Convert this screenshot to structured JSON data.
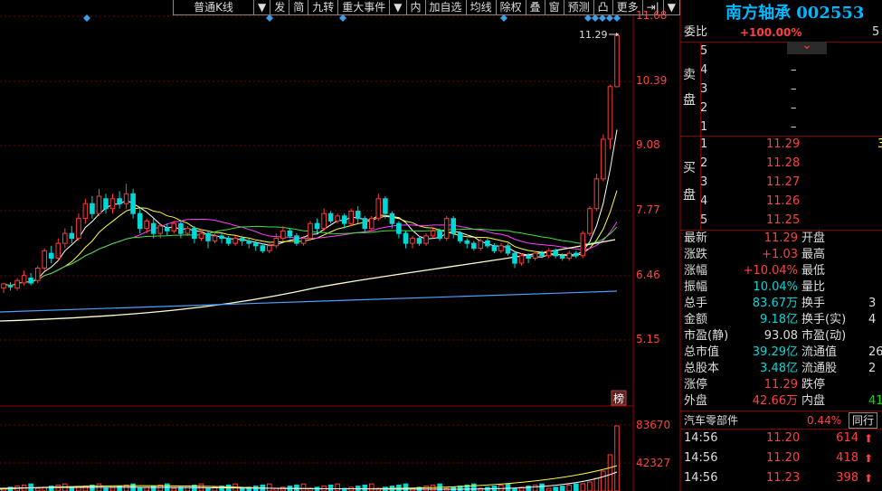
{
  "toolbar": {
    "buttons": [
      "普通K线",
      "▼",
      "发",
      "简",
      "九转",
      "重大事件",
      "▼",
      "内",
      "加自选",
      "均线",
      "除权",
      "叠",
      "窗",
      "预测",
      "凸",
      "更多",
      "⇥|",
      "▼"
    ]
  },
  "price_axis": [
    "11.68",
    "10.39",
    "9.08",
    "7.77",
    "6.46",
    "5.15"
  ],
  "volume_axis": [
    "83670",
    "42327"
  ],
  "chart_marker": "11.29",
  "bang_label": "榜",
  "stock": {
    "name": "南方轴承",
    "code": "002553"
  },
  "weibi": {
    "label": "委比",
    "value": "+100.00%",
    "extra": "5"
  },
  "sell_label": [
    "卖",
    "盘"
  ],
  "buy_label": [
    "买",
    "盘"
  ],
  "sell_rows": [
    {
      "level": "5",
      "price": "–"
    },
    {
      "level": "4",
      "price": "–"
    },
    {
      "level": "3",
      "price": "–"
    },
    {
      "level": "2",
      "price": "–"
    },
    {
      "level": "1",
      "price": "–"
    }
  ],
  "buy_rows": [
    {
      "level": "1",
      "price": "11.29",
      "vol": "3"
    },
    {
      "level": "2",
      "price": "11.28",
      "vol": ""
    },
    {
      "level": "3",
      "price": "11.27",
      "vol": ""
    },
    {
      "level": "4",
      "price": "11.26",
      "vol": ""
    },
    {
      "level": "5",
      "price": "11.25",
      "vol": ""
    }
  ],
  "quote": [
    {
      "l1": "最新",
      "v1": "11.29",
      "l2": "开盘",
      "v2": ""
    },
    {
      "l1": "涨跌",
      "v1": "+1.03",
      "l2": "最高",
      "v2": ""
    },
    {
      "l1": "涨幅",
      "v1": "+10.04%",
      "l2": "最低",
      "v2": ""
    },
    {
      "l1": "振幅",
      "v1": "10.04%",
      "l2": "量比",
      "v2": ""
    },
    {
      "l1": "总手",
      "v1": "83.67万",
      "l2": "换手",
      "v2": "3"
    },
    {
      "l1": "金额",
      "v1": "9.18亿",
      "l2": "换手(实)",
      "v2": "4"
    },
    {
      "l1": "市盈(静)",
      "v1": "93.08",
      "l2": "市盈(动)",
      "v2": ""
    },
    {
      "l1": "总市值",
      "v1": "39.29亿",
      "l2": "流通值",
      "v2": "26"
    },
    {
      "l1": "总股本",
      "v1": "3.48亿",
      "l2": "流通股",
      "v2": "2"
    },
    {
      "l1": "涨停",
      "v1": "11.29",
      "l2": "跌停",
      "v2": ""
    },
    {
      "l1": "外盘",
      "v1": "42.66万",
      "l2": "内盘",
      "v2": "41"
    }
  ],
  "sector": {
    "name": "汽车零部件",
    "pct": "0.44%",
    "button": "同行"
  },
  "ticks": [
    {
      "time": "14:56",
      "price": "11.20",
      "vol": "614"
    },
    {
      "time": "14:56",
      "price": "11.20",
      "vol": "418"
    },
    {
      "time": "14:56",
      "price": "11.23",
      "vol": "398"
    }
  ],
  "colors": {
    "up": "#ff3b3b",
    "down": "#00d8d8",
    "ma5": "#ffffff",
    "ma10": "#ffff40",
    "ma20": "#ff40ff",
    "ma30": "#40e040",
    "ma60": "#ffffd0",
    "ma120": "#4aa0ff"
  },
  "chart_data": {
    "type": "candlestick",
    "y_axis_ticks": [
      11.68,
      10.39,
      9.08,
      7.77,
      6.46,
      5.15
    ],
    "ylim": [
      5.15,
      11.68
    ],
    "candles": [
      [
        6.2,
        6.28,
        6.1,
        6.3
      ],
      [
        6.25,
        6.22,
        6.15,
        6.32
      ],
      [
        6.2,
        6.35,
        6.15,
        6.4
      ],
      [
        6.3,
        6.45,
        6.25,
        6.55
      ],
      [
        6.4,
        6.3,
        6.25,
        6.5
      ],
      [
        6.35,
        6.6,
        6.3,
        6.65
      ],
      [
        6.6,
        6.95,
        6.55,
        7.0
      ],
      [
        6.9,
        6.8,
        6.7,
        7.05
      ],
      [
        6.8,
        7.1,
        6.75,
        7.2
      ],
      [
        7.1,
        7.3,
        7.0,
        7.4
      ],
      [
        7.3,
        7.2,
        7.1,
        7.45
      ],
      [
        7.2,
        7.6,
        7.15,
        7.7
      ],
      [
        7.6,
        7.9,
        7.5,
        8.0
      ],
      [
        7.9,
        7.7,
        7.6,
        8.05
      ],
      [
        7.7,
        8.05,
        7.65,
        8.2
      ],
      [
        8.0,
        7.8,
        7.7,
        8.1
      ],
      [
        7.8,
        8.0,
        7.7,
        8.1
      ],
      [
        8.0,
        7.9,
        7.8,
        8.15
      ],
      [
        7.9,
        8.1,
        7.8,
        8.3
      ],
      [
        8.1,
        7.7,
        7.6,
        8.2
      ],
      [
        7.7,
        7.4,
        7.3,
        7.8
      ],
      [
        7.4,
        7.55,
        7.3,
        7.6
      ],
      [
        7.5,
        7.3,
        7.2,
        7.6
      ],
      [
        7.3,
        7.45,
        7.2,
        7.5
      ],
      [
        7.4,
        7.35,
        7.25,
        7.5
      ],
      [
        7.35,
        7.5,
        7.3,
        7.55
      ],
      [
        7.5,
        7.3,
        7.2,
        7.55
      ],
      [
        7.3,
        7.4,
        7.25,
        7.45
      ],
      [
        7.4,
        7.2,
        7.1,
        7.45
      ],
      [
        7.2,
        7.3,
        7.15,
        7.35
      ],
      [
        7.3,
        7.15,
        7.0,
        7.35
      ],
      [
        7.15,
        7.25,
        7.1,
        7.3
      ],
      [
        7.25,
        7.2,
        7.1,
        7.3
      ],
      [
        7.2,
        7.1,
        7.05,
        7.25
      ],
      [
        7.1,
        7.2,
        7.05,
        7.25
      ],
      [
        7.2,
        7.15,
        7.05,
        7.25
      ],
      [
        7.15,
        7.1,
        7.0,
        7.2
      ],
      [
        7.1,
        7.05,
        6.95,
        7.15
      ],
      [
        7.05,
        6.95,
        6.9,
        7.1
      ],
      [
        6.95,
        7.05,
        6.9,
        7.1
      ],
      [
        7.05,
        7.2,
        7.0,
        7.3
      ],
      [
        7.2,
        7.35,
        7.15,
        7.45
      ],
      [
        7.35,
        7.25,
        7.2,
        7.4
      ],
      [
        7.25,
        7.1,
        7.05,
        7.3
      ],
      [
        7.1,
        7.2,
        7.05,
        7.25
      ],
      [
        7.2,
        7.5,
        7.15,
        7.55
      ],
      [
        7.5,
        7.4,
        7.3,
        7.6
      ],
      [
        7.4,
        7.7,
        7.35,
        7.8
      ],
      [
        7.7,
        7.55,
        7.5,
        7.75
      ],
      [
        7.55,
        7.65,
        7.5,
        7.7
      ],
      [
        7.65,
        7.5,
        7.4,
        7.7
      ],
      [
        7.5,
        7.75,
        7.45,
        7.8
      ],
      [
        7.75,
        7.6,
        7.5,
        7.85
      ],
      [
        7.6,
        7.4,
        7.3,
        7.65
      ],
      [
        7.4,
        7.6,
        7.35,
        7.65
      ],
      [
        7.6,
        8.0,
        7.55,
        8.1
      ],
      [
        8.0,
        7.7,
        7.6,
        8.05
      ],
      [
        7.7,
        7.5,
        7.4,
        7.75
      ],
      [
        7.5,
        7.3,
        7.2,
        7.55
      ],
      [
        7.3,
        7.1,
        7.0,
        7.35
      ],
      [
        7.1,
        7.2,
        7.0,
        7.25
      ],
      [
        7.2,
        7.1,
        7.05,
        7.25
      ],
      [
        7.1,
        7.25,
        7.05,
        7.3
      ],
      [
        7.25,
        7.35,
        7.2,
        7.4
      ],
      [
        7.35,
        7.2,
        7.15,
        7.4
      ],
      [
        7.2,
        7.6,
        7.15,
        7.65
      ],
      [
        7.6,
        7.3,
        7.2,
        7.65
      ],
      [
        7.3,
        7.15,
        7.1,
        7.35
      ],
      [
        7.15,
        7.1,
        7.0,
        7.2
      ],
      [
        7.1,
        7.0,
        6.95,
        7.15
      ],
      [
        7.0,
        7.15,
        6.95,
        7.2
      ],
      [
        7.15,
        7.05,
        7.0,
        7.2
      ],
      [
        7.05,
        6.95,
        6.9,
        7.1
      ],
      [
        6.95,
        7.05,
        6.9,
        7.1
      ],
      [
        7.05,
        6.9,
        6.85,
        7.1
      ],
      [
        6.9,
        6.7,
        6.6,
        6.95
      ],
      [
        6.7,
        6.85,
        6.65,
        6.9
      ],
      [
        6.85,
        6.8,
        6.7,
        6.9
      ],
      [
        6.8,
        6.9,
        6.75,
        6.95
      ],
      [
        6.9,
        6.85,
        6.8,
        6.95
      ],
      [
        6.85,
        6.95,
        6.8,
        7.0
      ],
      [
        6.95,
        6.85,
        6.8,
        7.0
      ],
      [
        6.85,
        6.8,
        6.75,
        6.9
      ],
      [
        6.8,
        6.9,
        6.75,
        6.95
      ],
      [
        6.9,
        6.85,
        6.8,
        6.95
      ],
      [
        6.85,
        7.3,
        6.8,
        7.35
      ],
      [
        7.3,
        7.8,
        7.25,
        7.85
      ],
      [
        7.8,
        8.4,
        7.75,
        8.5
      ],
      [
        8.4,
        9.2,
        8.35,
        9.3
      ],
      [
        9.2,
        10.26,
        9.0,
        10.3
      ],
      [
        10.26,
        11.29,
        10.26,
        11.29
      ]
    ],
    "volume_ticks": [
      83670,
      42327
    ]
  }
}
